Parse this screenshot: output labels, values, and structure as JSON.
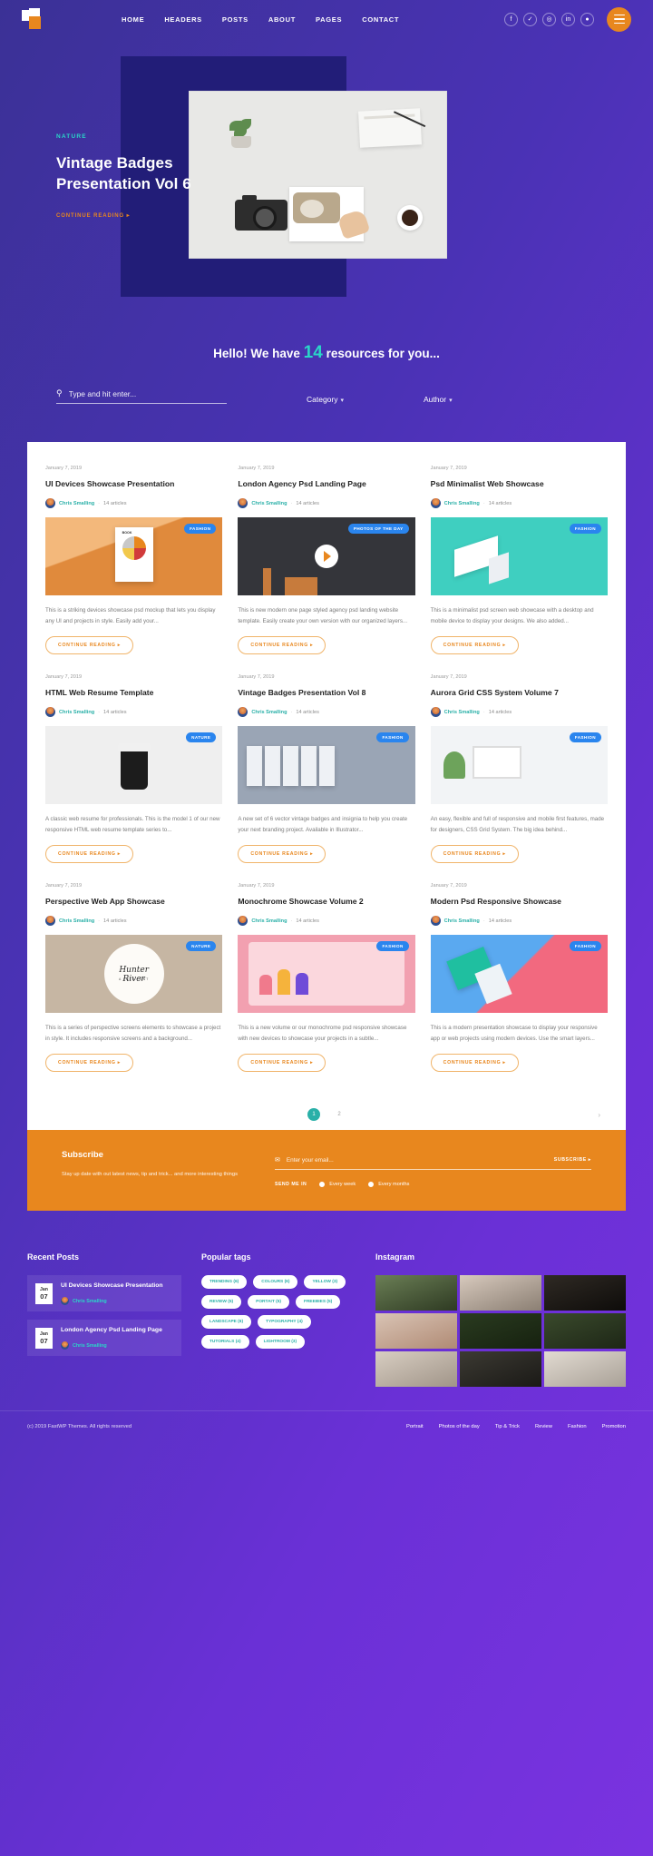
{
  "header": {
    "logo_name": "logo-icon",
    "nav": [
      {
        "label": "HOME"
      },
      {
        "label": "HEADERS"
      },
      {
        "label": "POSTS"
      },
      {
        "label": "ABOUT"
      },
      {
        "label": "PAGES"
      },
      {
        "label": "CONTACT"
      }
    ],
    "socials": [
      {
        "name": "facebook-icon",
        "glyph": "f"
      },
      {
        "name": "twitter-icon",
        "glyph": "✓"
      },
      {
        "name": "instagram-icon",
        "glyph": "◎"
      },
      {
        "name": "linkedin-icon",
        "glyph": "in"
      },
      {
        "name": "dribbble-icon",
        "glyph": "●"
      }
    ]
  },
  "hero": {
    "category": "NATURE",
    "title": "Vintage Badges\nPresentation Vol 6",
    "cta": "CONTINUE READING  ▸"
  },
  "results": {
    "prefix": "Hello! We have",
    "count": "14",
    "suffix": "resources for you...",
    "search_placeholder": "Type and hit enter...",
    "search_value": "",
    "category_label": "Category",
    "author_label": "Author",
    "caret": "▾"
  },
  "cards": [
    {
      "date": "January 7, 2019",
      "title": "UI Devices Showcase Presentation",
      "author": "Chris Smalling",
      "sep": "·",
      "articles": "14 articles",
      "badge": "FASHION",
      "thumb": "t-ui",
      "excerpt": "This is a striking devices showcase psd mockup that lets you display any UI and projects in style. Easily add your...",
      "button": "CONTINUE READING  ▸"
    },
    {
      "date": "January 7, 2019",
      "title": "London Agency Psd Landing Page",
      "author": "Chris Smalling",
      "sep": "·",
      "articles": "14 articles",
      "badge": "PHOTOS OF THE DAY",
      "thumb": "t-video",
      "excerpt": "This is new modern one page styled agency psd landing website template. Easily create your own version with our organized layers...",
      "button": "CONTINUE READING  ▸"
    },
    {
      "date": "January 7, 2019",
      "title": "Psd Minimalist Web Showcase",
      "author": "Chris Smalling",
      "sep": "·",
      "articles": "14 articles",
      "badge": "FASHION",
      "thumb": "t-min",
      "excerpt": "This is a minimalist psd screen web showcase with a desktop and mobile device to display your designs. We also added...",
      "button": "CONTINUE READING  ▸"
    },
    {
      "date": "January 7, 2019",
      "title": "HTML Web Resume Template",
      "author": "Chris Smalling",
      "sep": "·",
      "articles": "14 articles",
      "badge": "NATURE",
      "thumb": "t-cup",
      "excerpt": "A classic web resume for professionals. This is the model 1 of our new responsive HTML web resume template series to...",
      "button": "CONTINUE READING  ▸"
    },
    {
      "date": "January 7, 2019",
      "title": "Vintage Badges Presentation Vol 8",
      "author": "Chris Smalling",
      "sep": "·",
      "articles": "14 articles",
      "badge": "FASHION",
      "thumb": "t-screens",
      "excerpt": "A new set of 6 vector vintage badges and insignia to help you create your next branding project. Available in Illustrator...",
      "button": "CONTINUE READING  ▸"
    },
    {
      "date": "January 7, 2019",
      "title": "Aurora Grid CSS System Volume 7",
      "author": "Chris Smalling",
      "sep": "·",
      "articles": "14 articles",
      "badge": "FASHION",
      "thumb": "t-aurora",
      "excerpt": "An easy, flexible and full of responsive and mobile first features, made for designers, CSS Grid System. The big idea behind...",
      "button": "CONTINUE READING  ▸"
    },
    {
      "date": "January 7, 2019",
      "title": "Perspective Web App Showcase",
      "author": "Chris Smalling",
      "sep": "·",
      "articles": "14 articles",
      "badge": "NATURE",
      "thumb": "t-font",
      "excerpt": "This is a series of perspective screens elements to showcase a project in style. It includes responsive screens and a background...",
      "button": "CONTINUE READING  ▸"
    },
    {
      "date": "January 7, 2019",
      "title": "Monochrome Showcase Volume 2",
      "author": "Chris Smalling",
      "sep": "·",
      "articles": "14 articles",
      "badge": "FASHION",
      "thumb": "t-mono",
      "excerpt": "This is a new volume or our monochrome psd responsive showcase with new devices to showcase your projects in a subtle...",
      "button": "CONTINUE READING  ▸"
    },
    {
      "date": "January 7, 2019",
      "title": "Modern Psd Responsive Showcase",
      "author": "Chris Smalling",
      "sep": "·",
      "articles": "14 articles",
      "badge": "FASHION",
      "thumb": "t-resp",
      "excerpt": "This is a modern presentation showcase to display your responsive app or web projects using modern devices. Use the smart layers...",
      "button": "CONTINUE READING  ▸"
    }
  ],
  "pagination": {
    "pages": [
      "1",
      "2"
    ],
    "active": "1",
    "next": "›"
  },
  "subscribe": {
    "title": "Subscribe",
    "text": "Stay up date with out latest news, tip and trick... and more interesting things",
    "email_placeholder": "Enter your email...",
    "email_value": "",
    "submit": "SUBSCRIBE  ▸",
    "send_label": "SEND ME IN",
    "options": [
      {
        "label": "Every week",
        "selected": true
      },
      {
        "label": "Every months",
        "selected": false
      }
    ]
  },
  "footer": {
    "recent_title": "Recent Posts",
    "recent": [
      {
        "month": "Jan",
        "day": "07",
        "title": "UI Devices Showcase Presentation",
        "author": "Chris Smalling"
      },
      {
        "month": "Jan",
        "day": "07",
        "title": "London Agency Psd Landing Page",
        "author": "Chris Smalling"
      }
    ],
    "tags_title": "Popular tags",
    "tags": [
      "TRENDING (6)",
      "COLOURS (6)",
      "YELLOW (3)",
      "REVIEW (5)",
      "PORTAIT (5)",
      "FREEBIES (5)",
      "LANDSCAPE (6)",
      "TYPOGRAPHY (4)",
      "TUTORIALS (4)",
      "LIGHTROOM (3)"
    ],
    "instagram_title": "Instagram",
    "copyright": "(c) 2019 FastWP Themes. All rights reserved",
    "links": [
      "Portrait",
      "Photos of the day",
      "Tip & Trick",
      "Review",
      "Fashion",
      "Promotion"
    ]
  }
}
